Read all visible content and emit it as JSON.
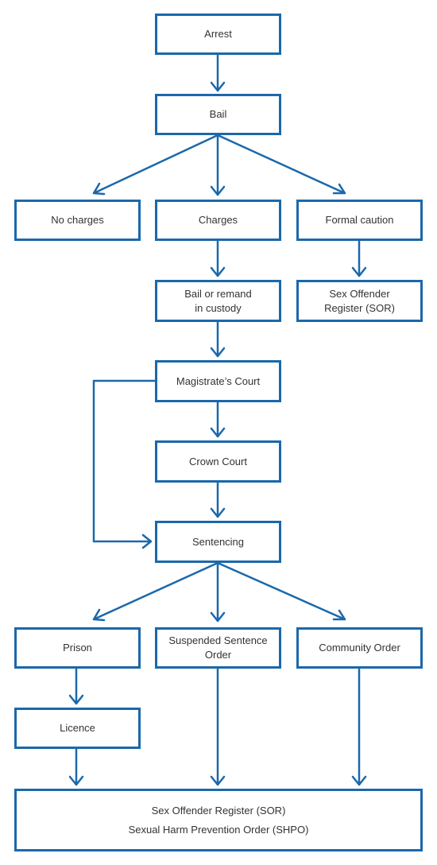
{
  "color": "#1b68ab",
  "nodes": {
    "arrest": "Arrest",
    "bail": "Bail",
    "no_charges": "No charges",
    "charges": "Charges",
    "formal_caution": "Formal caution",
    "bail_remand_1": "Bail or remand",
    "bail_remand_2": "in custody",
    "sor_1": "Sex Offender",
    "sor_2": "Register (SOR)",
    "magistrates": "Magistrate’s Court",
    "crown": "Crown Court",
    "sentencing": "Sentencing",
    "prison": "Prison",
    "suspended_1": "Suspended Sentence",
    "suspended_2": "Order",
    "community": "Community Order",
    "licence": "Licence",
    "final_1": "Sex Offender Register (SOR)",
    "final_2": "Sexual Harm Prevention Order (SHPO)"
  }
}
